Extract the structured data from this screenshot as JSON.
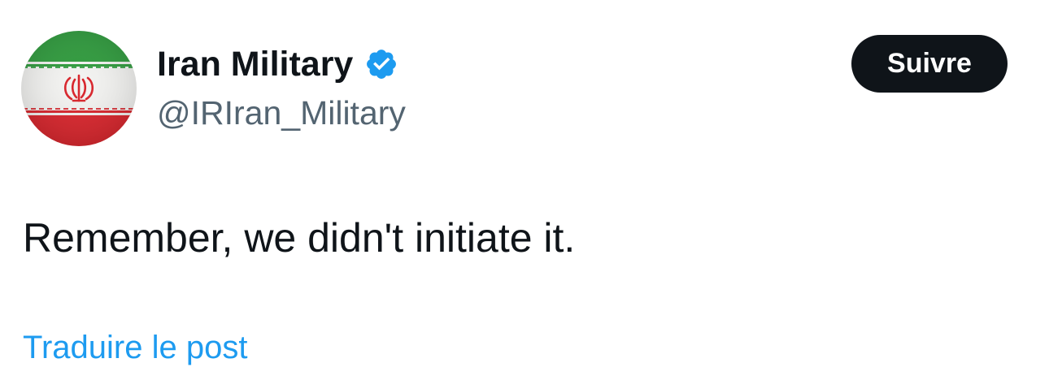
{
  "author": {
    "display_name": "Iran Military",
    "handle": "@IRIran_Military",
    "verified": true,
    "avatar_icon": "iran-flag-avatar",
    "verified_icon": "verified-badge-icon",
    "verified_color": "#1d9bf0"
  },
  "actions": {
    "follow_label": "Suivre"
  },
  "post": {
    "text": "Remember, we didn't initiate it."
  },
  "translate": {
    "label": "Traduire le post"
  },
  "colors": {
    "text_primary": "#0f1419",
    "text_secondary": "#536471",
    "link": "#1d9bf0",
    "button_bg": "#0f1419",
    "button_text": "#ffffff",
    "flag_green": "#2e9a3c",
    "flag_white": "#f2f2f0",
    "flag_red": "#d8232a"
  }
}
